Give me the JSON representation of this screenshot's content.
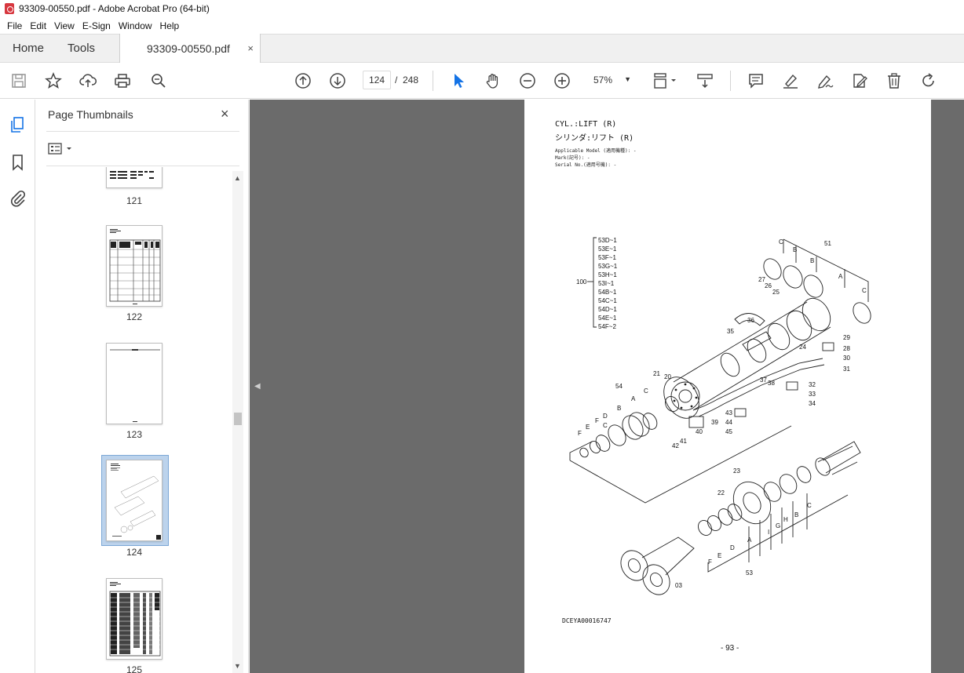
{
  "window": {
    "title": "93309-00550.pdf - Adobe Acrobat Pro (64-bit)"
  },
  "menu": [
    "File",
    "Edit",
    "View",
    "E-Sign",
    "Window",
    "Help"
  ],
  "tabs": {
    "home": "Home",
    "tools": "Tools",
    "document": "93309-00550.pdf",
    "close": "×"
  },
  "toolbar": {
    "current_page": "124",
    "separator": "/",
    "total_pages": "248",
    "zoom": "57%"
  },
  "thumbnails": {
    "title": "Page Thumbnails",
    "close": "×",
    "pages": [
      {
        "label": "121"
      },
      {
        "label": "122"
      },
      {
        "label": "123"
      },
      {
        "label": "124",
        "selected": true
      },
      {
        "label": "125"
      }
    ]
  },
  "page": {
    "title_en": "CYL.:LIFT (R)",
    "title_jp": "シリンダ:リフト (R)",
    "meta": [
      "Applicable Model (適用機種): -",
      "Mark(記号): -",
      "Serial No.(適用号機): -"
    ],
    "drawing_code": "DCEYA00016747",
    "page_number": "- 93 -",
    "group_label": "100",
    "group_items": [
      "53D~1",
      "53E~1",
      "53F~1",
      "53G~1",
      "53H~1",
      "53I~1",
      "54B~1",
      "54C~1",
      "54D~1",
      "54E~1",
      "54F~2"
    ],
    "callouts": [
      "C",
      "B",
      "B",
      "51",
      "A",
      "C",
      "27",
      "26",
      "25",
      "36",
      "35",
      "29",
      "28",
      "24",
      "30",
      "31",
      "21",
      "20",
      "37",
      "38",
      "32",
      "33",
      "34",
      "54",
      "C",
      "A",
      "B",
      "D",
      "C",
      "F",
      "E",
      "F",
      "43",
      "44",
      "45",
      "39",
      "40",
      "41",
      "42",
      "23",
      "22",
      "C",
      "B",
      "H",
      "G",
      "I",
      "A",
      "D",
      "E",
      "F",
      "03",
      "53"
    ]
  },
  "colors": {
    "accent": "#1473e6",
    "doc_background": "#6b6b6b",
    "selected_thumb": "#bcd3ec"
  }
}
